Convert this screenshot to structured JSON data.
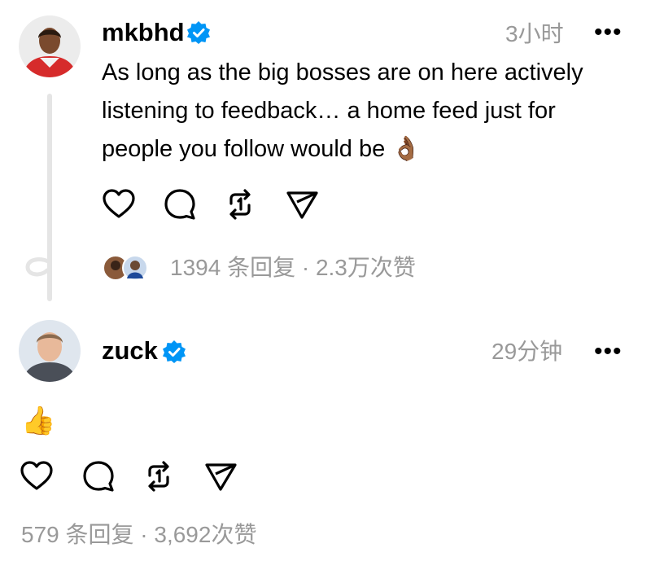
{
  "posts": [
    {
      "username": "mkbhd",
      "time": "3小时",
      "text_lines": [
        "As long as the big bosses are on here actively",
        "listening to feedback… a home feed just for",
        "people you follow would be"
      ],
      "emoji": "👌🏾",
      "meta": "1394 条回复 · 2.3万次赞"
    },
    {
      "username": "zuck",
      "time": "29分钟",
      "emoji": "👍",
      "meta": "579 条回复 · 3,692次赞"
    }
  ],
  "more_glyph": "•••",
  "icons": [
    "heart-icon",
    "comment-icon",
    "repost-icon",
    "share-icon",
    "verified-badge-icon",
    "more-icon"
  ],
  "colors": {
    "verified": "#0095f6",
    "secondary_text": "#999999",
    "thread_line": "#e5e5e5"
  }
}
